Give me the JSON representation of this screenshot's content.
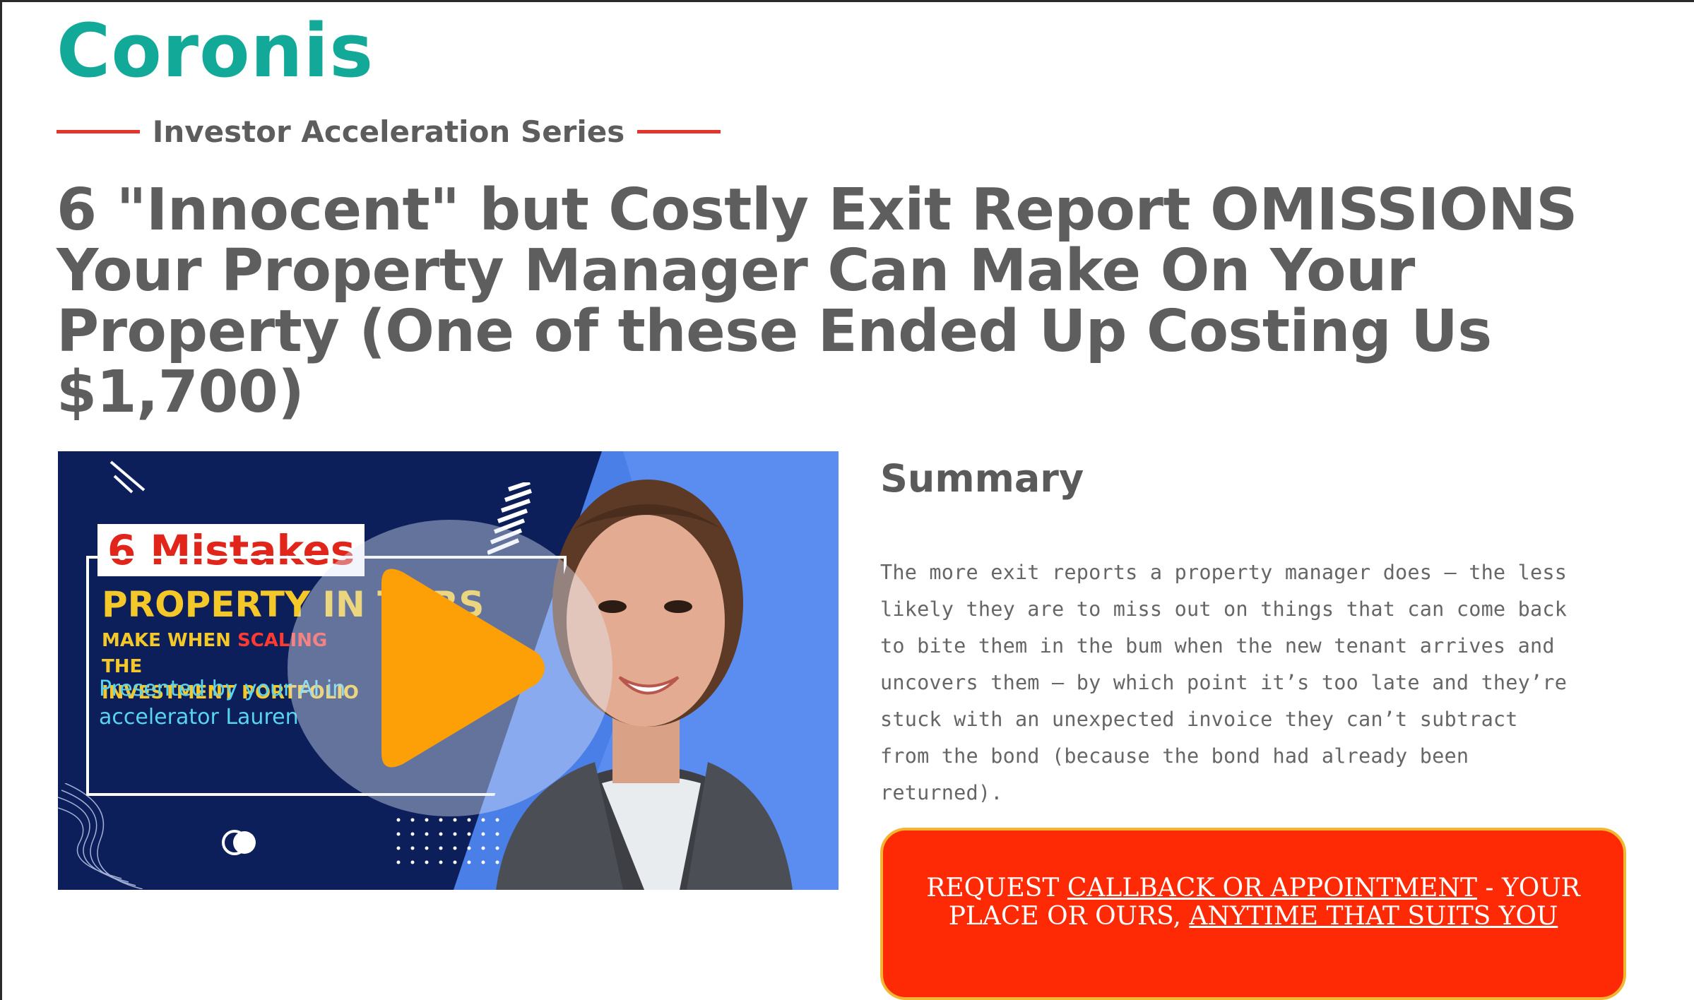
{
  "brand": {
    "name": "Coronis",
    "color": "#12a999"
  },
  "series": {
    "label": "Investor Acceleration Series",
    "accent": "#e5342c"
  },
  "headline": "6 \"Innocent\" but Costly Exit Report OMISSIONS Your Property Manager Can Make On Your Property (One of these Ended Up Costing Us $1,700)",
  "video": {
    "badge": "6 Mistakes",
    "title": "PROPERTY IN   TORS",
    "subtitle_part1": "MAKE WHEN ",
    "subtitle_red": "SCALING",
    "subtitle_part2": " THE",
    "subtitle_line2": "INVESTMENT PORTFOLIO",
    "presenter_line1": "Presented by your AI in",
    "presenter_line2": "accelerator Lauren",
    "play_icon": "play-icon",
    "play_color": "#fda008"
  },
  "summary": {
    "title": "Summary",
    "text": "The more exit reports a property manager does – the less likely they are to miss out on things that can come back to bite them in the bum when the new tenant arrives and uncovers them – by which point it’s too late and they’re stuck with an unexpected invoice they can’t subtract from the bond (because the bond had already been returned)."
  },
  "cta": {
    "part1": "REQUEST ",
    "link1": "CALLBACK OR APPOINTMENT",
    "part2": " - YOUR PLACE OR OURS, ",
    "link2": "ANYTIME THAT SUITS YOU",
    "background": "#fe2a06",
    "border": "#f2b632"
  }
}
